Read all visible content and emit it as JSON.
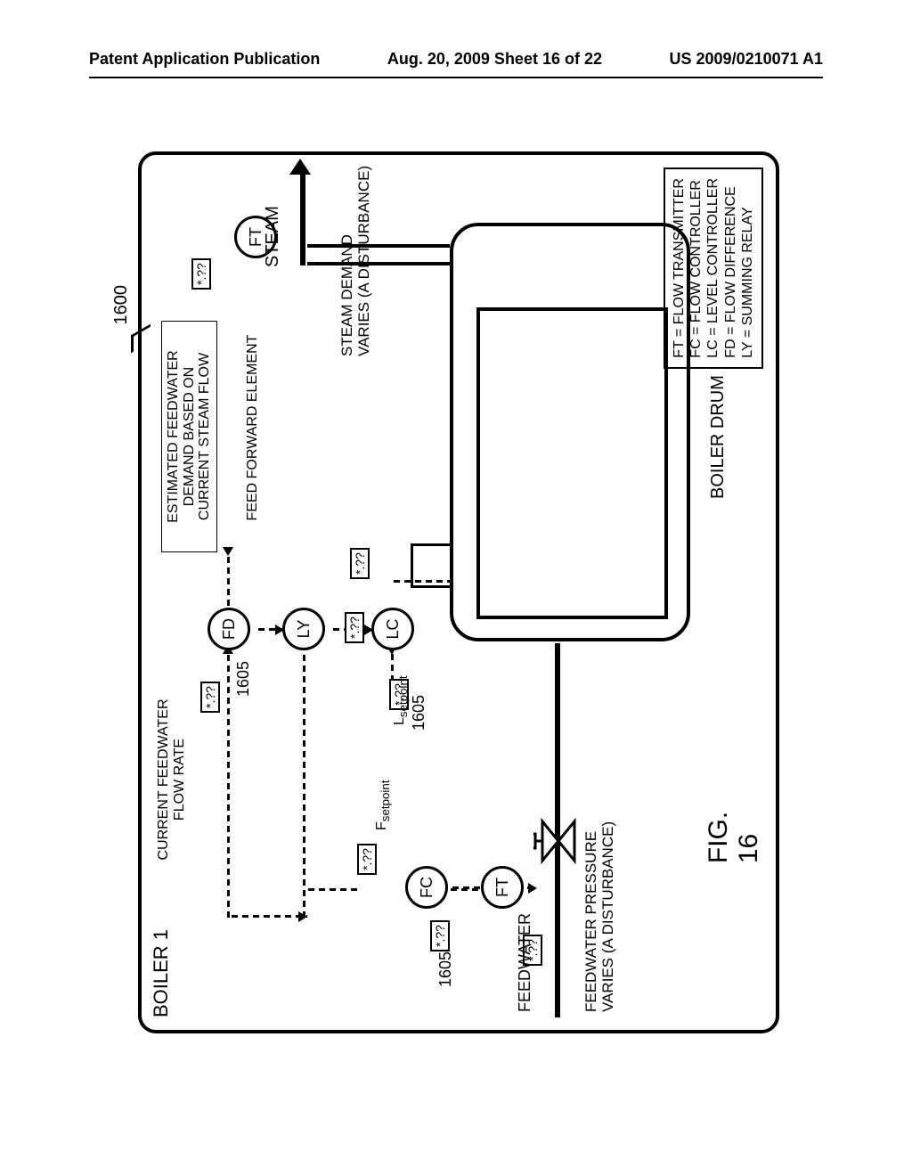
{
  "header": {
    "left": "Patent Application Publication",
    "center": "Aug. 20, 2009  Sheet 16 of 22",
    "right": "US 2009/0210071 A1"
  },
  "figure": {
    "ref_main": "1600",
    "title": "BOILER 1",
    "feedwater_note": "CURRENT FEEDWATER\nFLOW RATE",
    "estimated_note": "ESTIMATED FEEDWATER\nDEMAND BASED ON\nCURRENT STEAM FLOW",
    "feed_forward_label": "FEED FORWARD ELEMENT",
    "unit_tag": "*.??",
    "ref1605": "1605",
    "setpoint_L": "L",
    "setpoint_L_sub": "setpoint",
    "setpoint_F": "F",
    "setpoint_F_sub": "setpoint",
    "circle_FD": "FD",
    "circle_FT": "FT",
    "circle_LY": "LY",
    "circle_LC": "LC",
    "circle_FC": "FC",
    "feedwater_label": "FEEDWATER",
    "feedwater_disturb": "FEEDWATER PRESSURE\nVARIES (A DISTURBANCE)",
    "steam_label": "STEAM",
    "steam_disturb": "STEAM DEMAND\nVARIES (A DISTURBANCE)",
    "drum_label": "BOILER DRUM",
    "caption": "FIG. 16"
  },
  "legend": {
    "ft": "FT = FLOW TRANSMITTER",
    "fc": "FC = FLOW CONTROLLER",
    "lc": "LC = LEVEL CONTROLLER",
    "fd": "FD = FLOW DIFFERENCE",
    "ly": "LY = SUMMING RELAY"
  }
}
